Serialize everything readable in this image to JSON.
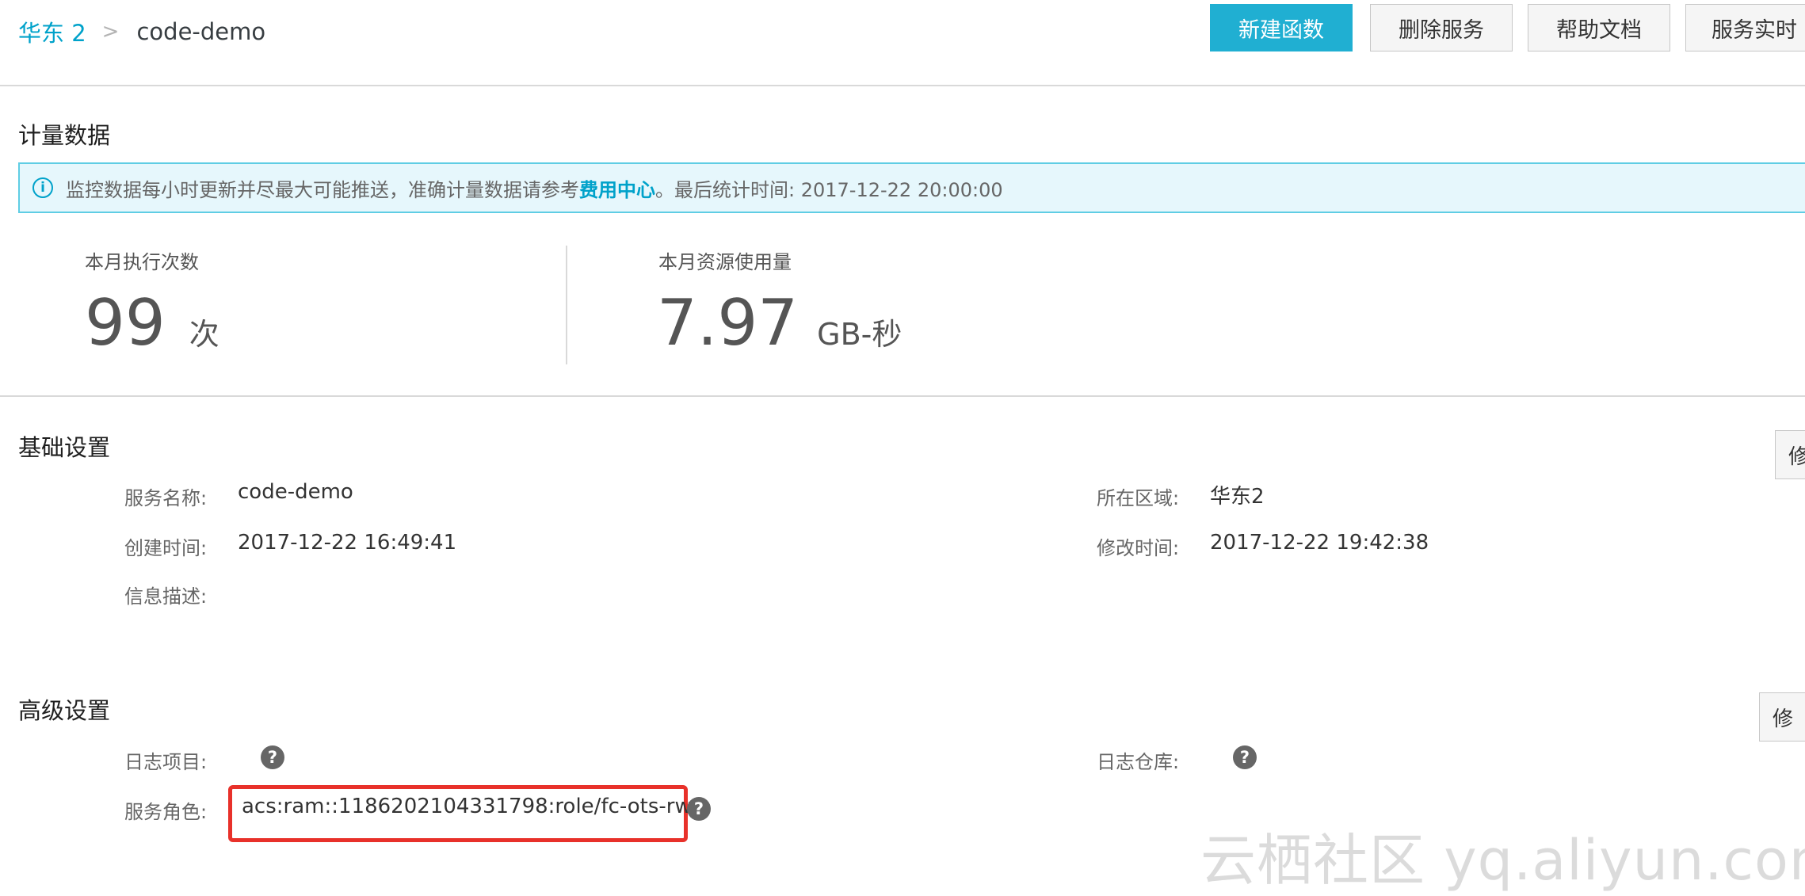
{
  "header": {
    "breadcrumb_region": "华东 2",
    "breadcrumb_separator": ">",
    "breadcrumb_service": "code-demo",
    "buttons": {
      "new_function": "新建函数",
      "delete_service": "删除服务",
      "help_docs": "帮助文档",
      "realtime": "服务实时"
    }
  },
  "metering": {
    "title": "计量数据",
    "banner_text": "监控数据每小时更新并尽最大可能推送，准确计量数据请参考",
    "banner_link": "费用中心",
    "banner_suffix": "。最后统计时间: 2017-12-22 20:00:00",
    "invocations_label": "本月执行次数",
    "invocations_value": "99",
    "invocations_unit": "次",
    "usage_label": "本月资源使用量",
    "usage_value": "7.97",
    "usage_unit": "GB-秒"
  },
  "basic": {
    "title": "基础设置",
    "edit_button": "修",
    "service_name_label": "服务名称:",
    "service_name_value": "code-demo",
    "region_label": "所在区域:",
    "region_value": "华东2",
    "created_label": "创建时间:",
    "created_value": "2017-12-22 16:49:41",
    "modified_label": "修改时间:",
    "modified_value": "2017-12-22 19:42:38",
    "description_label": "信息描述:",
    "description_value": ""
  },
  "advanced": {
    "title": "高级设置",
    "edit_button": "修",
    "log_project_label": "日志项目:",
    "logstore_label": "日志仓库:",
    "role_label": "服务角色:",
    "role_value": "acs:ram::1186202104331798:role/fc-ots-rw",
    "help_glyph": "?"
  },
  "watermark": "云栖社区 yq.aliyun.com",
  "colors": {
    "accent": "#00a2ca",
    "primary_button": "#20afd2",
    "banner_bg": "#e6f7fc",
    "highlight_box": "#e8312a"
  }
}
